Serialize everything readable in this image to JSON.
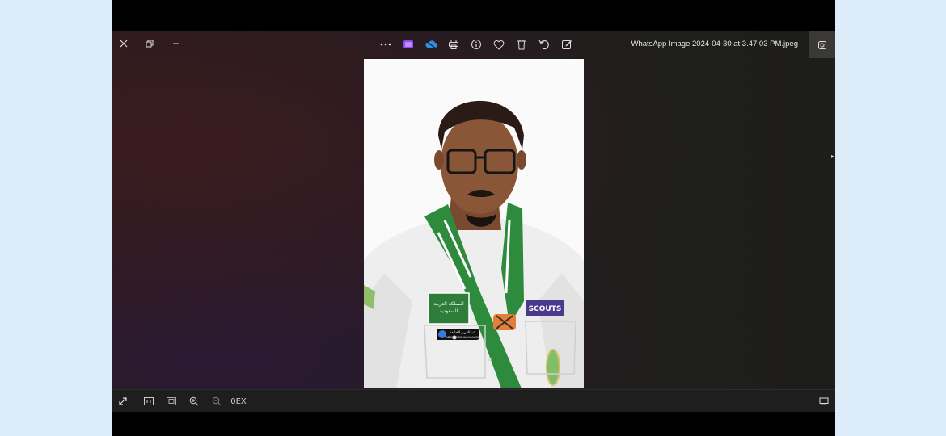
{
  "window": {
    "filename": "WhatsApp Image 2024-04-30 at 3.47.03 PM.jpeg",
    "controls": [
      "close-icon",
      "restore-icon",
      "minimize-icon"
    ]
  },
  "toolbar": {
    "items": [
      "more-icon",
      "clipchamp-icon",
      "onedrive-icon",
      "print-icon",
      "info-icon",
      "favorite-icon",
      "delete-icon",
      "rotate-icon",
      "edit-icon"
    ]
  },
  "image": {
    "badge_left_line1": "المملكة العربية",
    "badge_left_line2": "السعودية",
    "badge_scouts": "SCOUTS",
    "name_tag_arabic": "عبدالعزيز الخليفة",
    "name_tag_latin": "ABDULAZIZ AL-KHALIFA"
  },
  "bottombar": {
    "zoom_text": "0EX",
    "items": [
      "fullscreen-icon",
      "actual-size-icon",
      "fit-icon",
      "zoom-in-icon",
      "zoom-out-icon"
    ]
  },
  "colors": {
    "accent_scarf": "#2e8b3e",
    "scouts_badge": "#4b3a8c"
  }
}
